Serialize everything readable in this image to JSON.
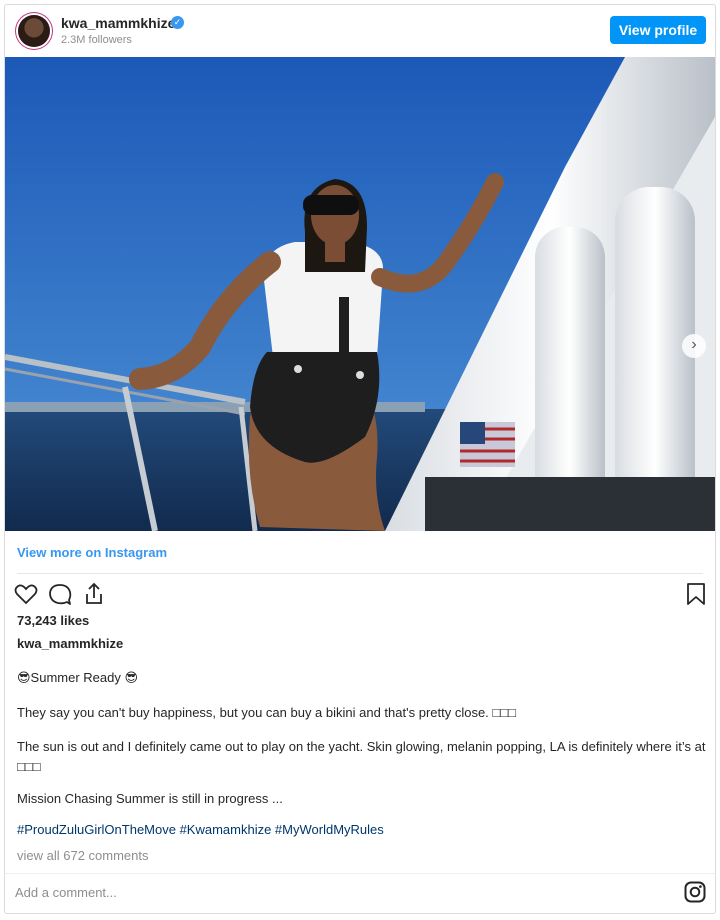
{
  "header": {
    "username": "kwa_mammkhize",
    "verified_icon": "✓",
    "followers": "2.3M followers",
    "view_profile_label": "View profile"
  },
  "post": {
    "view_more_label": "View more on Instagram",
    "likes": "73,243 likes",
    "caption_username": "kwa_mammkhize",
    "caption_lines": [
      "😎Summer Ready 😎",
      "They say you can't buy happiness, but you can buy a bikini and that's pretty close. □□□",
      "The sun is out and I definitely came out to play on the yacht. Skin glowing, melanin popping, LA is definitely where it’s at □□□",
      "Mission Chasing Summer is still in progress ..."
    ],
    "hashtags": "#ProudZuluGirlOnTheMove #Kwamamkhize #MyWorldMyRules",
    "comments_link": "view all 672 comments",
    "add_comment_placeholder": "Add a comment..."
  },
  "icons": {
    "like": "heart-icon",
    "comment": "comment-icon",
    "share": "share-icon",
    "save": "bookmark-icon",
    "instagram": "instagram-icon",
    "next": "chevron-right-icon"
  },
  "colors": {
    "accent": "#0095f6",
    "link": "#3897f0",
    "hashtag": "#00376b",
    "muted": "#8e8e8e"
  }
}
